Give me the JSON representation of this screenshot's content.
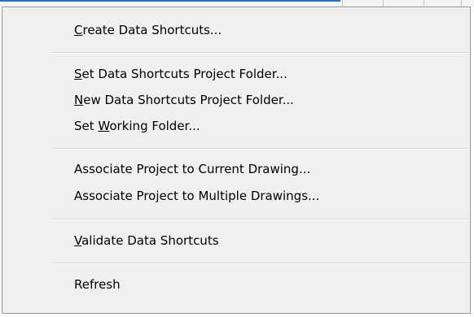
{
  "menu": {
    "items": [
      {
        "key": "C",
        "rest": "reate Data Shortcuts..."
      },
      {
        "key": "S",
        "rest": "et Data Shortcuts Project Folder..."
      },
      {
        "key": "N",
        "rest": "ew Data Shortcuts Project Folder..."
      },
      {
        "pre": "Set ",
        "key": "W",
        "rest": "orking Folder..."
      },
      {
        "label": "Associate Project to Current Drawing..."
      },
      {
        "label": "Associate Project to Multiple Drawings..."
      },
      {
        "key": "V",
        "rest": "alidate Data Shortcuts"
      },
      {
        "label": "Refresh"
      }
    ]
  }
}
